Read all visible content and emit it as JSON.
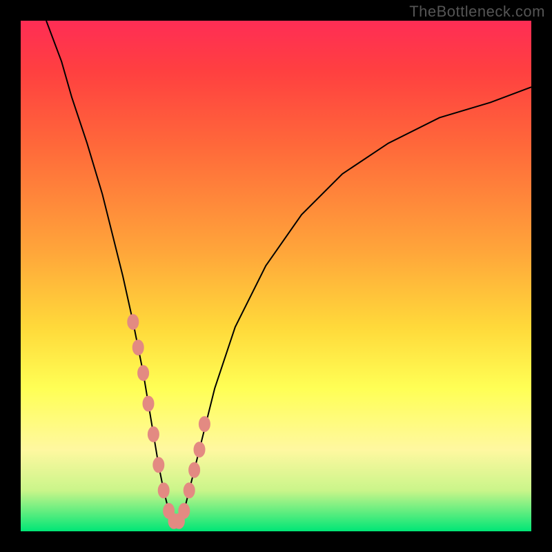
{
  "watermark": "TheBottleneck.com",
  "colors": {
    "frame": "#000000",
    "gradient_top": "#ff2d55",
    "gradient_mid": "#ffff55",
    "gradient_bottom": "#00e676",
    "curve": "#000000",
    "marker": "#e38a82"
  },
  "chart_data": {
    "type": "line",
    "title": "",
    "xlabel": "",
    "ylabel": "",
    "xlim": [
      0,
      100
    ],
    "ylim": [
      0,
      100
    ],
    "series": [
      {
        "name": "bottleneck-curve",
        "x": [
          5,
          8,
          10,
          13,
          16,
          18,
          20,
          22,
          24,
          25,
          26,
          27,
          28,
          29,
          30,
          31,
          32,
          33,
          35,
          38,
          42,
          48,
          55,
          63,
          72,
          82,
          92,
          100
        ],
        "values": [
          100,
          92,
          85,
          76,
          66,
          58,
          50,
          41,
          31,
          25,
          19,
          13,
          8,
          4,
          2,
          2,
          4,
          8,
          16,
          28,
          40,
          52,
          62,
          70,
          76,
          81,
          84,
          87
        ]
      }
    ],
    "markers": {
      "name": "highlighted-points",
      "x": [
        22,
        23,
        24,
        25,
        26,
        27,
        28,
        29,
        30,
        31,
        32,
        33,
        34,
        35,
        36
      ],
      "values": [
        41,
        36,
        31,
        25,
        19,
        13,
        8,
        4,
        2,
        2,
        4,
        8,
        12,
        16,
        21
      ]
    }
  }
}
